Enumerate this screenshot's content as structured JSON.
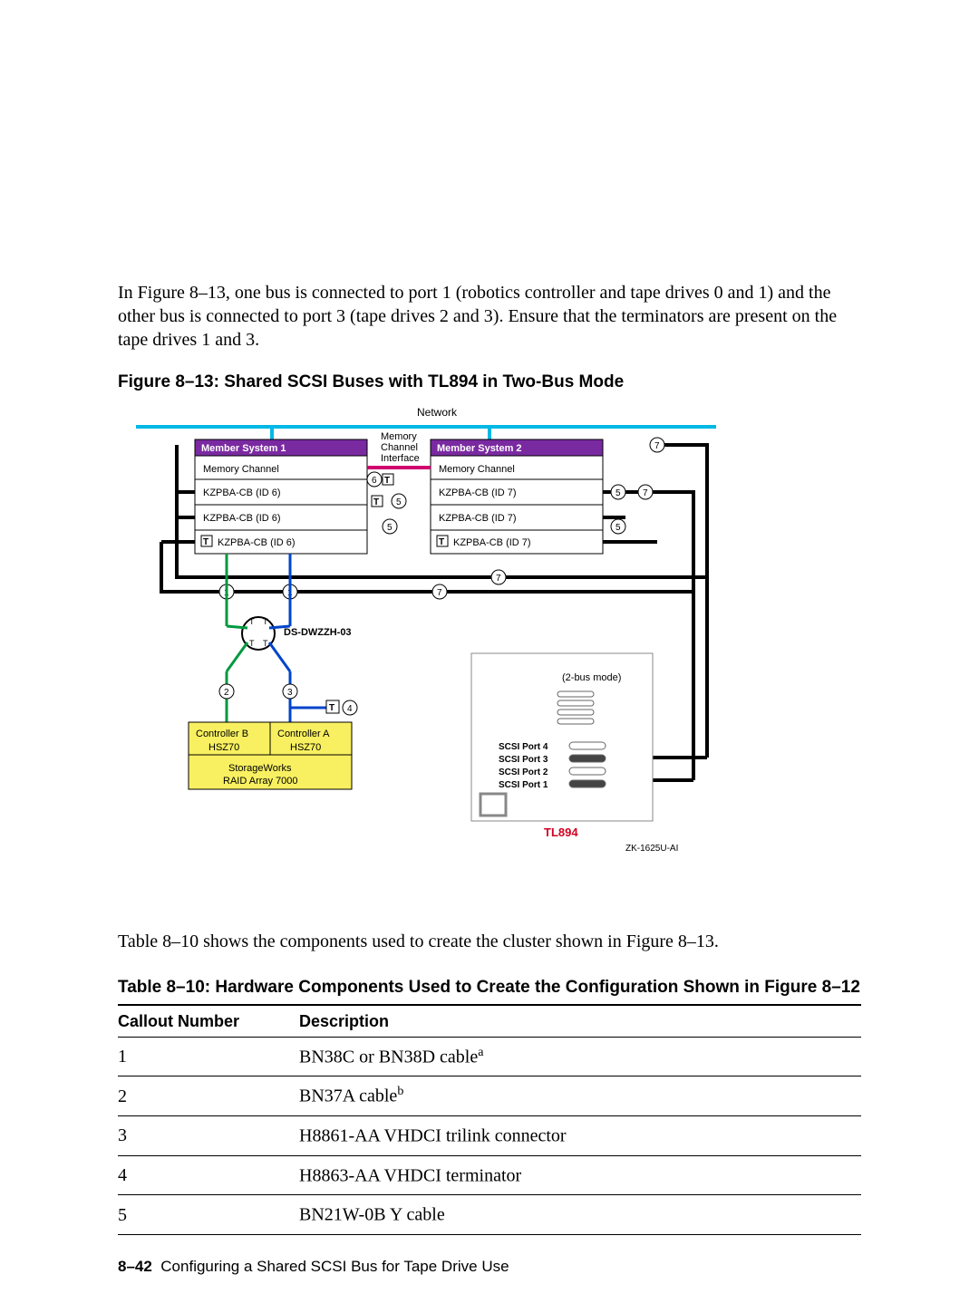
{
  "intro": "In Figure 8–13, one bus is connected to port 1 (robotics controller and tape drives 0 and 1) and the other bus is connected to port 3 (tape drives 2 and 3). Ensure that the terminators are present on the tape drives 1 and 3.",
  "figure": {
    "caption": "Figure 8–13: Shared SCSI Buses with TL894 in Two-Bus Mode",
    "network_label": "Network",
    "mci_line1": "Memory",
    "mci_line2": "Channel",
    "mci_line3": "Interface",
    "member1": {
      "title": "Member System 1",
      "rows": [
        "Memory Channel",
        "KZPBA-CB (ID 6)",
        "KZPBA-CB (ID 6)",
        "KZPBA-CB (ID 6)"
      ]
    },
    "member2": {
      "title": "Member System 2",
      "rows": [
        "Memory Channel",
        "KZPBA-CB (ID 7)",
        "KZPBA-CB (ID 7)",
        "KZPBA-CB (ID 7)"
      ]
    },
    "t_marker": "T",
    "callouts": {
      "c1": "1",
      "c2": "2",
      "c3": "3",
      "c4": "4",
      "c5": "5",
      "c6": "6",
      "c7": "7"
    },
    "hub_label": "DS-DWZZH-03",
    "controllers": {
      "b": "Controller B",
      "a": "Controller A",
      "hsz": "HSZ70"
    },
    "raid_line1": "StorageWorks",
    "raid_line2": "RAID Array 7000",
    "tl894": {
      "mode": "(2-bus mode)",
      "port4": "SCSI Port 4",
      "port3": "SCSI Port 3",
      "port2": "SCSI Port 2",
      "port1": "SCSI Port 1",
      "name": "TL894"
    },
    "figid": "ZK-1625U-AI"
  },
  "midtext": "Table 8–10 shows the components used to create the cluster shown in Figure 8–13.",
  "table": {
    "caption": "Table 8–10: Hardware Components Used to Create the Configuration Shown in Figure 8–12",
    "col1": "Callout Number",
    "col2": "Description",
    "rows": [
      {
        "num": "1",
        "desc": "BN38C or BN38D cable",
        "sup": "a"
      },
      {
        "num": "2",
        "desc": "BN37A cable",
        "sup": "b"
      },
      {
        "num": "3",
        "desc": "H8861-AA VHDCI trilink connector",
        "sup": ""
      },
      {
        "num": "4",
        "desc": "H8863-AA VHDCI terminator",
        "sup": ""
      },
      {
        "num": "5",
        "desc": "BN21W-0B Y cable",
        "sup": ""
      }
    ]
  },
  "footer": {
    "pagenum": "8–42",
    "title": "Configuring a Shared SCSI Bus for Tape Drive Use"
  }
}
